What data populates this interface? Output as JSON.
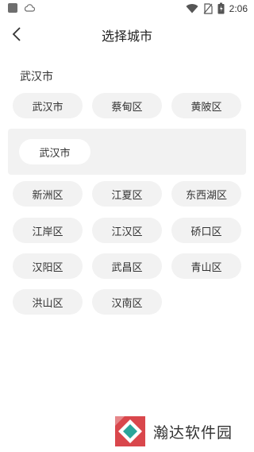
{
  "status_bar": {
    "time": "2:06",
    "icons": [
      "app-square-icon",
      "cloud-icon",
      "wifi-icon",
      "no-sim-icon",
      "battery-icon"
    ]
  },
  "header": {
    "title": "选择城市",
    "back_icon": "chevron-left-icon"
  },
  "section": {
    "label": "武汉市"
  },
  "top_row": [
    "武汉市",
    "蔡甸区",
    "黄陂区"
  ],
  "popup": {
    "selected": "武汉市"
  },
  "districts": [
    [
      "新洲区",
      "江夏区",
      "东西湖区"
    ],
    [
      "江岸区",
      "江汉区",
      "硚口区"
    ],
    [
      "汉阳区",
      "武昌区",
      "青山区"
    ],
    [
      "洪山区",
      "汉南区"
    ]
  ],
  "watermark": {
    "text": "瀚达软件园"
  },
  "colors": {
    "chip_bg": "#f2f2f2",
    "text": "#333333",
    "logo_red": "#d9474c",
    "logo_teal": "#2ba59a"
  }
}
